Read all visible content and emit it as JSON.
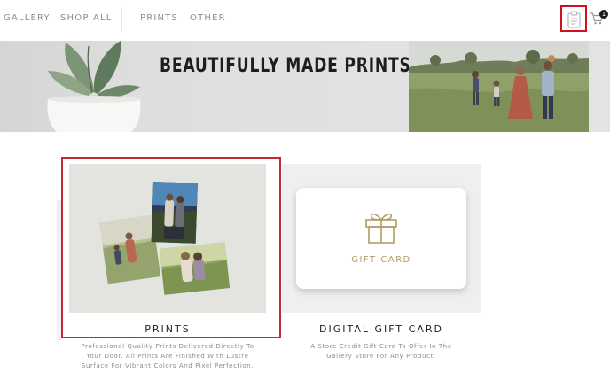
{
  "nav": {
    "items": [
      {
        "label": "GALLERY"
      },
      {
        "label": "SHOP ALL"
      },
      {
        "label": "PRINTS"
      },
      {
        "label": "OTHER"
      }
    ],
    "cart_count": "1"
  },
  "icons": {
    "clipboard": "clipboard-icon",
    "cart": "shopping-cart-icon",
    "gift": "gift-box-icon"
  },
  "banner": {
    "title": "BEAUTIFULLY MADE PRINTS"
  },
  "products": [
    {
      "title": "PRINTS",
      "description": "Professional Quality Prints Delivered Directly To Your Door. All Prints Are Finished With Lustre Surface For Vibrant Colors And Pixel Perfection."
    },
    {
      "title": "DIGITAL GIFT CARD",
      "card_label": "GIFT CARD",
      "description": "A Store Credit Gift Card To Offer In The Gallery Store For Any Product."
    }
  ],
  "colors": {
    "highlight": "#d20f1e",
    "gift_accent": "#b39b63",
    "nav_text": "#8d8d8d"
  }
}
